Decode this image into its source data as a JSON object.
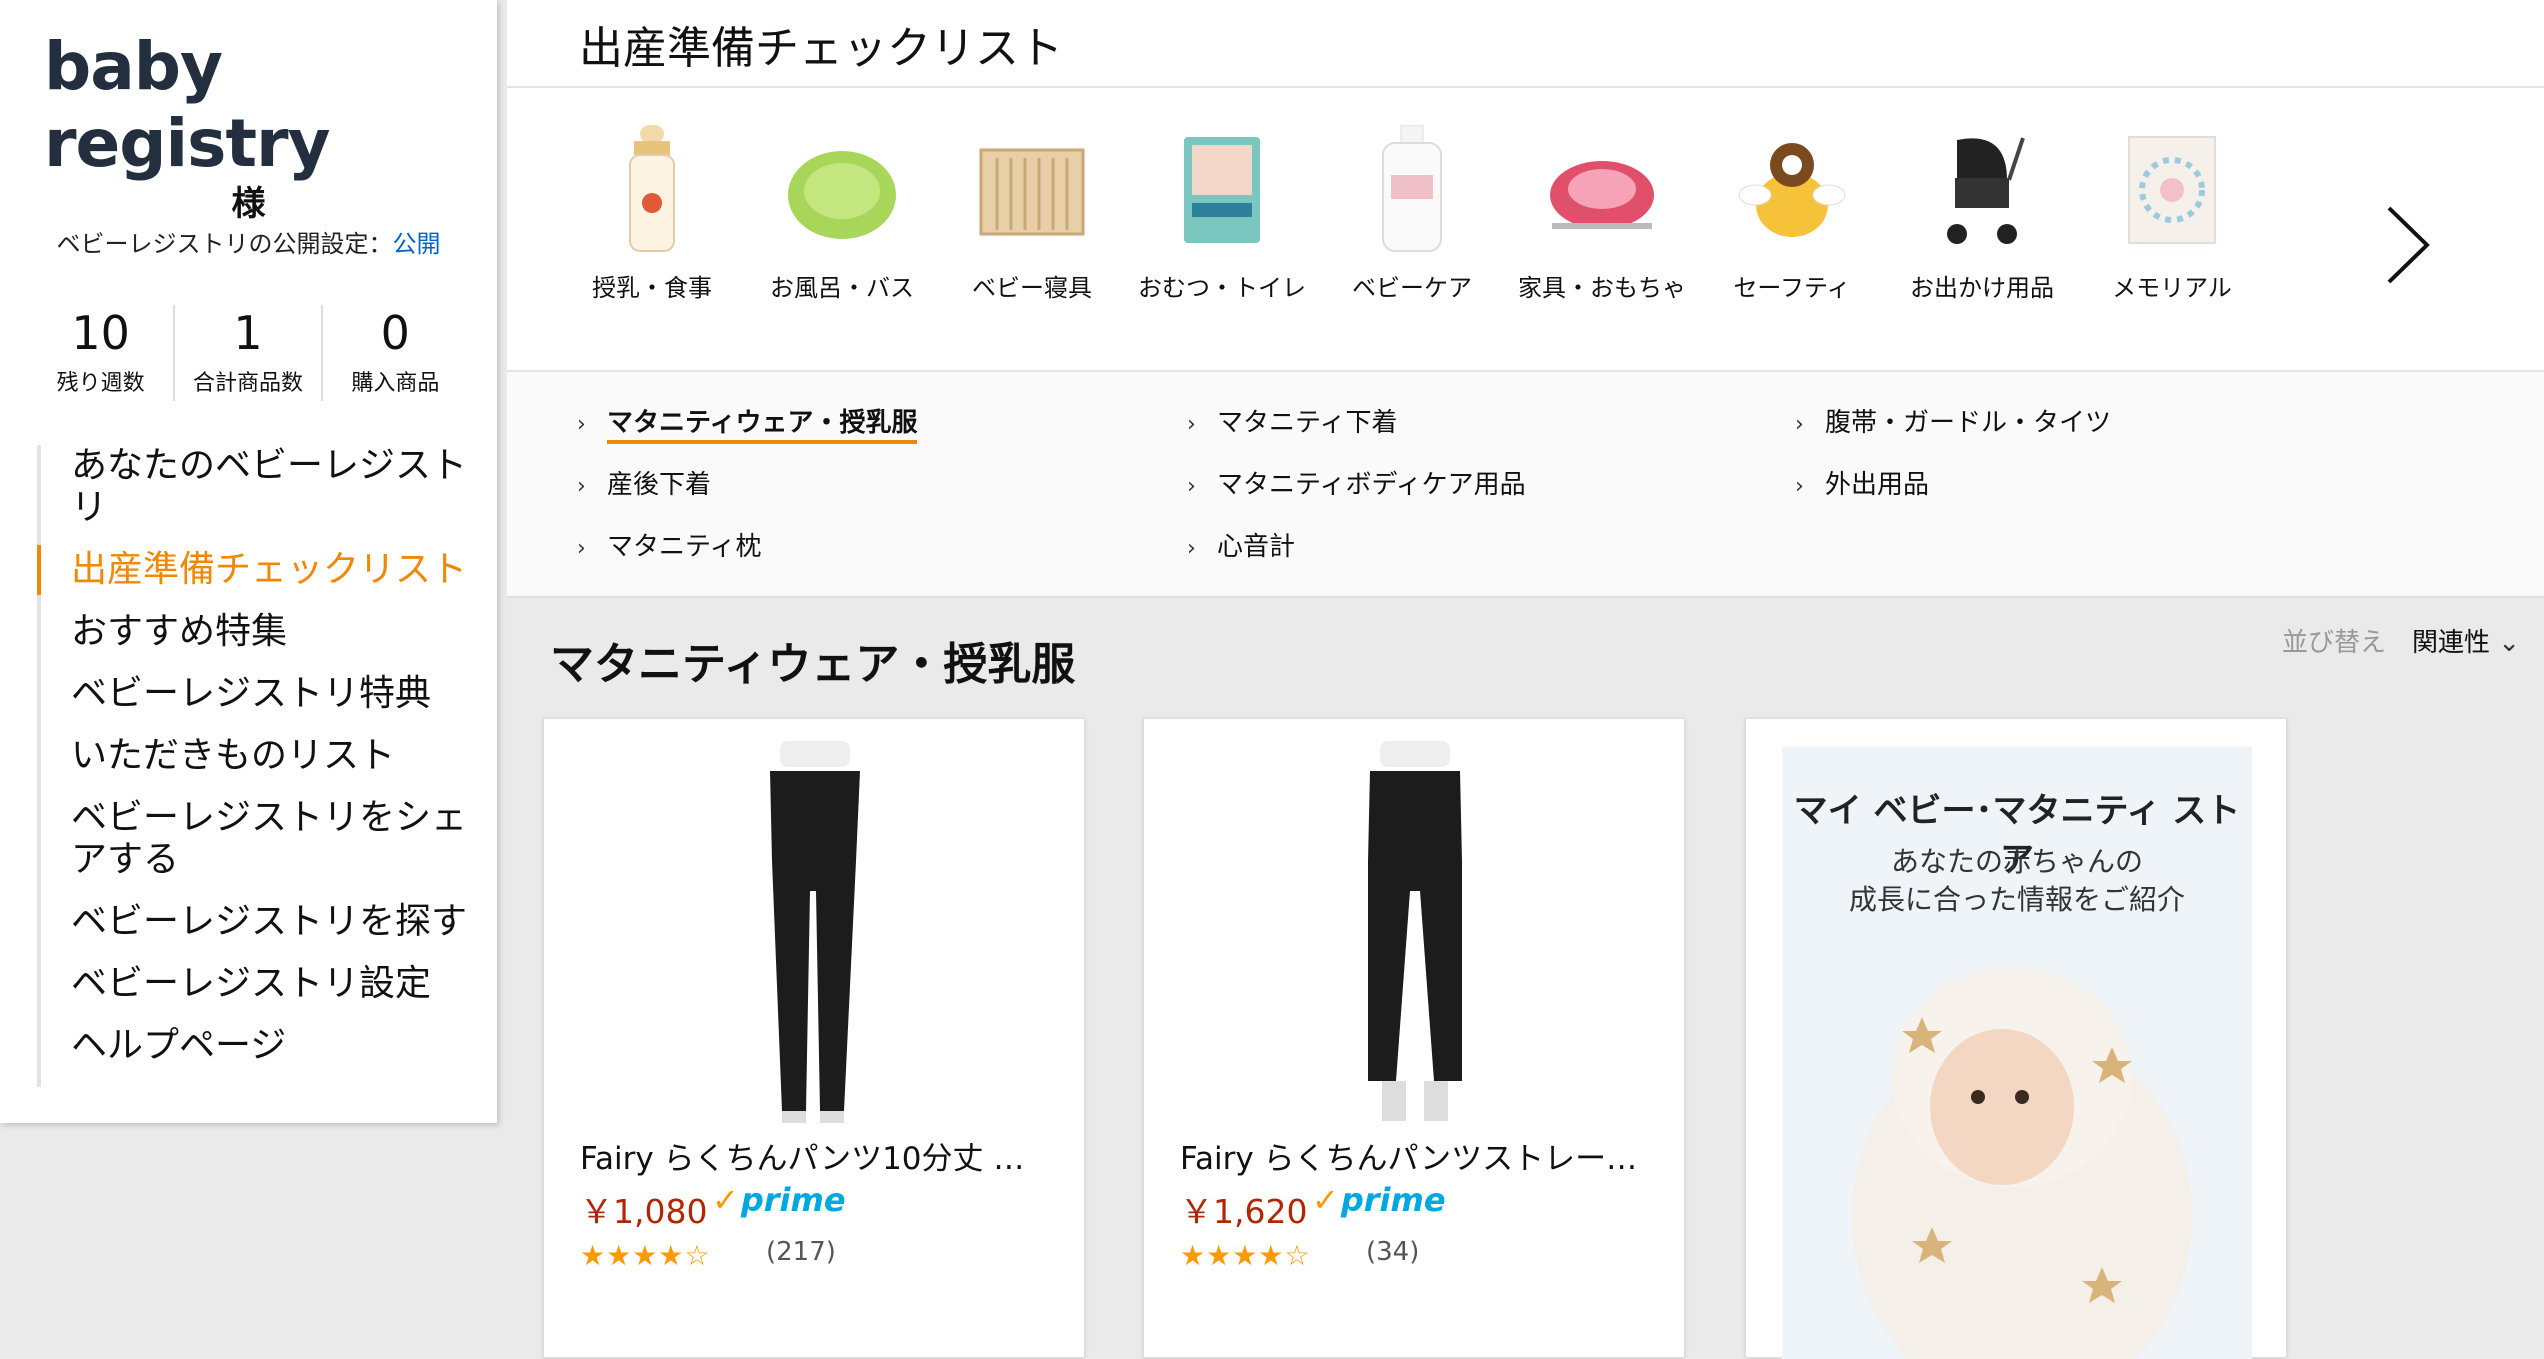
{
  "sidebar": {
    "logo": "baby registry",
    "greeting": "様",
    "privacy_label": "ベビーレジストリの公開設定：",
    "privacy_value": "公開",
    "stats": [
      {
        "num": "10",
        "label": "残り週数"
      },
      {
        "num": "1",
        "label": "合計商品数"
      },
      {
        "num": "0",
        "label": "購入商品"
      }
    ],
    "nav": [
      {
        "label": "あなたのベビーレジストリ"
      },
      {
        "label": "出産準備チェックリスト",
        "active": true
      },
      {
        "label": "おすすめ特集"
      },
      {
        "label": "ベビーレジストリ特典"
      },
      {
        "label": "いただきものリスト"
      },
      {
        "label": "ベビーレジストリをシェアする"
      },
      {
        "label": "ベビーレジストリを探す"
      },
      {
        "label": "ベビーレジストリ設定"
      },
      {
        "label": "ヘルプページ"
      }
    ]
  },
  "page_title": "出産準備チェックリスト",
  "categories": [
    {
      "label": "授乳・食事",
      "icon": "baby-bottle-icon"
    },
    {
      "label": "お風呂・バス",
      "icon": "baby-bath-icon"
    },
    {
      "label": "ベビー寝具",
      "icon": "crib-icon"
    },
    {
      "label": "おむつ・トイレ",
      "icon": "diapers-icon"
    },
    {
      "label": "ベビーケア",
      "icon": "lotion-icon"
    },
    {
      "label": "家具・おもちゃ",
      "icon": "bouncer-icon"
    },
    {
      "label": "セーフティ",
      "icon": "head-guard-icon"
    },
    {
      "label": "お出かけ用品",
      "icon": "stroller-icon"
    },
    {
      "label": "メモリアル",
      "icon": "memorial-frame-icon"
    }
  ],
  "subcategories": [
    {
      "label": "マタニティウェア・授乳服",
      "active": true
    },
    {
      "label": "マタニティ下着"
    },
    {
      "label": "腹帯・ガードル・タイツ"
    },
    {
      "label": "産後下着"
    },
    {
      "label": "マタニティボディケア用品"
    },
    {
      "label": "外出用品"
    },
    {
      "label": "マタニティ枕"
    },
    {
      "label": "心音計"
    }
  ],
  "section_title": "マタニティウェア・授乳服",
  "sort": {
    "label": "並び替え",
    "value": "関連性"
  },
  "products": [
    {
      "name": "Fairy らくちんパンツ10分丈 ベ…",
      "price": "￥1,080",
      "prime": "prime",
      "rating": 4,
      "count": "(217)"
    },
    {
      "name": "Fairy らくちんパンツストレート…",
      "price": "￥1,620",
      "prime": "prime",
      "rating": 4,
      "count": "(34)"
    }
  ],
  "ad": {
    "headline": "マイ ベビー･マタニティ ストア",
    "sub1": "あなたの赤ちゃんの",
    "sub2": "成長に合った情報をご紹介"
  },
  "colors": {
    "accent": "#f08804",
    "price": "#b12704",
    "prime": "#00a8e1",
    "link": "#0066c0"
  }
}
